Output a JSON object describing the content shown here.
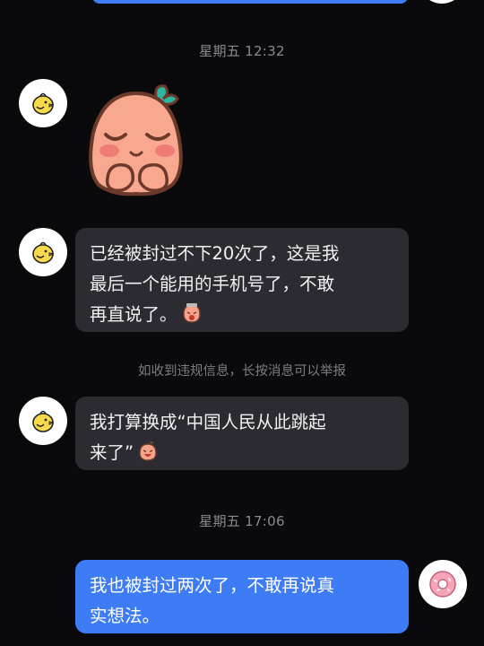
{
  "timestamps": {
    "friday_morning": "星期五 12:32",
    "friday_evening": "星期五 17:06"
  },
  "messages": {
    "msg1": {
      "line1": "已经被封过不下20次了，这是我",
      "line2": "最后一个能用的手机号了，不敢",
      "line3": "再直说了。"
    },
    "msg2": {
      "line1": "我打算换成“中国人民从此跳起",
      "line2": "来了”"
    },
    "msg3": {
      "line1": "我也被封过两次了，不敢再说真",
      "line2": "实想法。"
    }
  },
  "system_notice": "如收到违规信息，长按消息可以举报",
  "colors": {
    "background": "#0a0a0c",
    "incoming_bubble": "#2b2b31",
    "outgoing_bubble": "#3d7cf5",
    "timestamp_text": "#8a8a90"
  },
  "icons": {
    "contact_avatar": "yellow-chick-icon",
    "own_avatar": "pink-donut-icon",
    "sticker": "blushing-peach-sticker",
    "emoji_crying": "crying-face-emoji",
    "emoji_laughing": "laughing-face-emoji"
  }
}
